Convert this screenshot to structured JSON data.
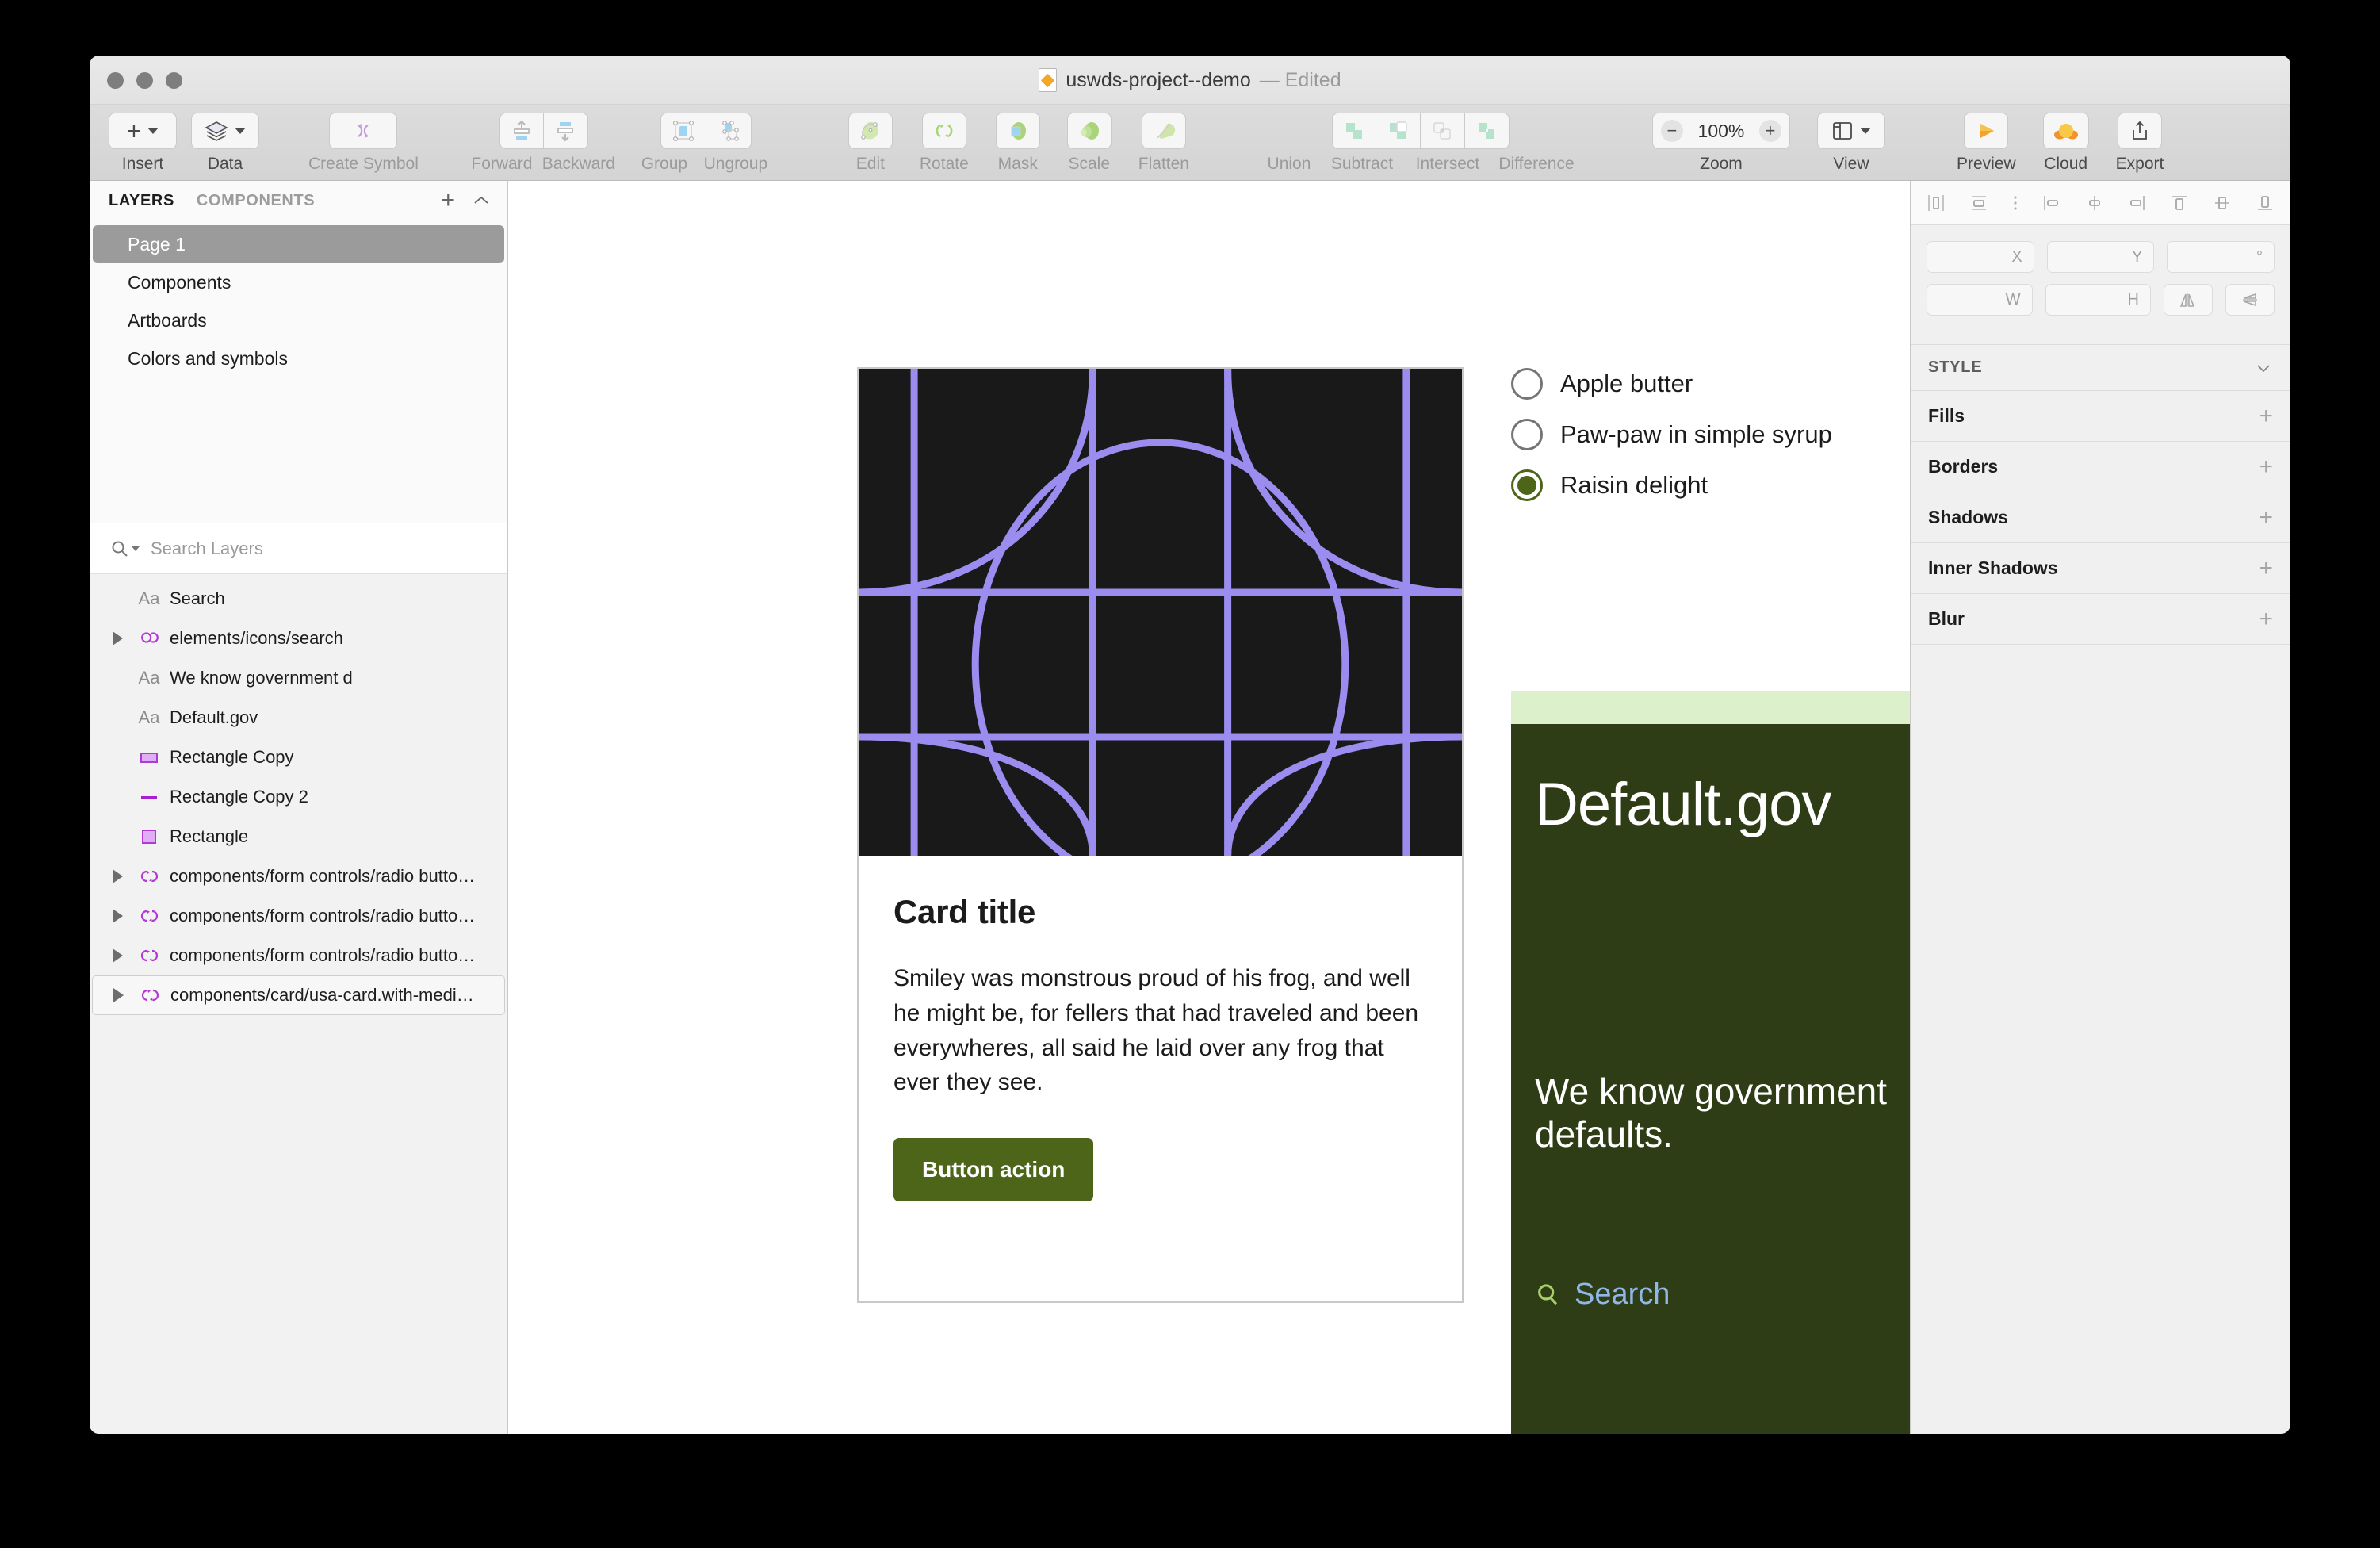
{
  "window": {
    "title": "uswds-project--demo",
    "title_suffix": "— Edited"
  },
  "toolbar": {
    "insert": {
      "label": "Insert",
      "icon": "plus-icon"
    },
    "data": {
      "label": "Data",
      "icon": "layers-stack-icon"
    },
    "create_symbol": {
      "label": "Create Symbol",
      "icon": "symbol-refresh-icon"
    },
    "forward": {
      "label": "Forward",
      "icon": "bring-forward-icon"
    },
    "backward": {
      "label": "Backward",
      "icon": "send-backward-icon"
    },
    "group": {
      "label": "Group",
      "icon": "group-icon"
    },
    "ungroup": {
      "label": "Ungroup",
      "icon": "ungroup-icon"
    },
    "edit": {
      "label": "Edit",
      "icon": "edit-path-icon"
    },
    "rotate": {
      "label": "Rotate",
      "icon": "rotate-copies-icon"
    },
    "mask": {
      "label": "Mask",
      "icon": "mask-icon"
    },
    "scale": {
      "label": "Scale",
      "icon": "scale-icon"
    },
    "flatten": {
      "label": "Flatten",
      "icon": "flatten-icon"
    },
    "union": {
      "label": "Union",
      "icon": "boolean-union-icon"
    },
    "subtract": {
      "label": "Subtract",
      "icon": "boolean-subtract-icon"
    },
    "intersect": {
      "label": "Intersect",
      "icon": "boolean-intersect-icon"
    },
    "difference": {
      "label": "Difference",
      "icon": "boolean-difference-icon"
    },
    "zoom": {
      "label": "Zoom",
      "value": "100%",
      "minus": "−",
      "plus": "+"
    },
    "view": {
      "label": "View",
      "icon": "layout-panels-icon"
    },
    "preview": {
      "label": "Preview",
      "icon": "play-triangle-icon"
    },
    "cloud": {
      "label": "Cloud",
      "icon": "cloud-icon"
    },
    "export": {
      "label": "Export",
      "icon": "share-upload-icon"
    }
  },
  "sidebar": {
    "tabs": [
      {
        "label": "LAYERS",
        "active": true
      },
      {
        "label": "COMPONENTS",
        "active": false
      }
    ],
    "add_icon": "plus-icon",
    "collapse_icon": "chevron-up-icon",
    "pages": [
      {
        "label": "Page 1",
        "selected": true
      },
      {
        "label": "Components",
        "selected": false
      },
      {
        "label": "Artboards",
        "selected": false
      },
      {
        "label": "Colors and symbols",
        "selected": false
      }
    ],
    "search": {
      "placeholder": "Search Layers",
      "icon": "search-icon"
    },
    "layers": [
      {
        "name": "Search",
        "type": "text",
        "disclosure": false,
        "selected": false
      },
      {
        "name": "elements/icons/search",
        "type": "symbol",
        "disclosure": true,
        "selected": false
      },
      {
        "name": "We know government d",
        "type": "text",
        "disclosure": false,
        "selected": false
      },
      {
        "name": "Default.gov",
        "type": "text",
        "disclosure": false,
        "selected": false
      },
      {
        "name": "Rectangle Copy",
        "type": "rect-filled",
        "disclosure": false,
        "selected": false
      },
      {
        "name": "Rectangle Copy 2",
        "type": "line",
        "disclosure": false,
        "selected": false
      },
      {
        "name": "Rectangle",
        "type": "rect-square",
        "disclosure": false,
        "selected": false
      },
      {
        "name": "components/form controls/radio butto…",
        "type": "symbol",
        "disclosure": true,
        "selected": false
      },
      {
        "name": "components/form controls/radio butto…",
        "type": "symbol",
        "disclosure": true,
        "selected": false
      },
      {
        "name": "components/form controls/radio butto…",
        "type": "symbol",
        "disclosure": true,
        "selected": false
      },
      {
        "name": "components/card/usa-card.with-medi…",
        "type": "symbol",
        "disclosure": true,
        "selected": true
      }
    ]
  },
  "canvas": {
    "card": {
      "title": "Card title",
      "body": "Smiley was monstrous proud of his frog, and well he might be, for fellers that had traveled and been everywheres, all said he laid over any frog that ever they see.",
      "button_label": "Button action",
      "button_color": "#4c6519",
      "media_bg": "#191919",
      "media_line_color": "#9b8cf0"
    },
    "radios": {
      "options": [
        {
          "label": "Apple butter",
          "selected": false
        },
        {
          "label": "Paw-paw in simple syrup",
          "selected": false
        },
        {
          "label": "Raisin delight",
          "selected": true
        }
      ],
      "selected_color": "#4c6519"
    },
    "gov_card": {
      "stripe_color": "#dcf0cb",
      "bg_color": "#2f3d16",
      "title": "Default.gov",
      "subtitle": "We know government defaults.",
      "search_label": "Search",
      "search_icon": "search-icon",
      "search_link_color": "#8fb8e8",
      "search_icon_color": "#a9cf6a"
    }
  },
  "inspector": {
    "align_icons": [
      "align-left-icon",
      "align-center-horizontal-icon",
      "align-distribute-icon",
      "align-edge-left-icon",
      "align-middle-icon",
      "align-edge-right-icon",
      "align-top-icon",
      "align-center-vertical-icon",
      "align-bottom-icon"
    ],
    "geometry": {
      "x_label": "X",
      "y_label": "Y",
      "rotation_label": "°",
      "w_label": "W",
      "h_label": "H",
      "flip_horizontal_icon": "flip-horizontal-icon",
      "flip_vertical_icon": "flip-vertical-icon",
      "x_value": "",
      "y_value": "",
      "rotation_value": "",
      "w_value": "",
      "h_value": ""
    },
    "style_header": {
      "label": "STYLE",
      "collapse_icon": "chevron-down-icon"
    },
    "style_rows": [
      {
        "label": "Fills",
        "add_icon": "plus-icon"
      },
      {
        "label": "Borders",
        "add_icon": "plus-icon"
      },
      {
        "label": "Shadows",
        "add_icon": "plus-icon"
      },
      {
        "label": "Inner Shadows",
        "add_icon": "plus-icon"
      },
      {
        "label": "Blur",
        "add_icon": "plus-icon"
      }
    ]
  }
}
